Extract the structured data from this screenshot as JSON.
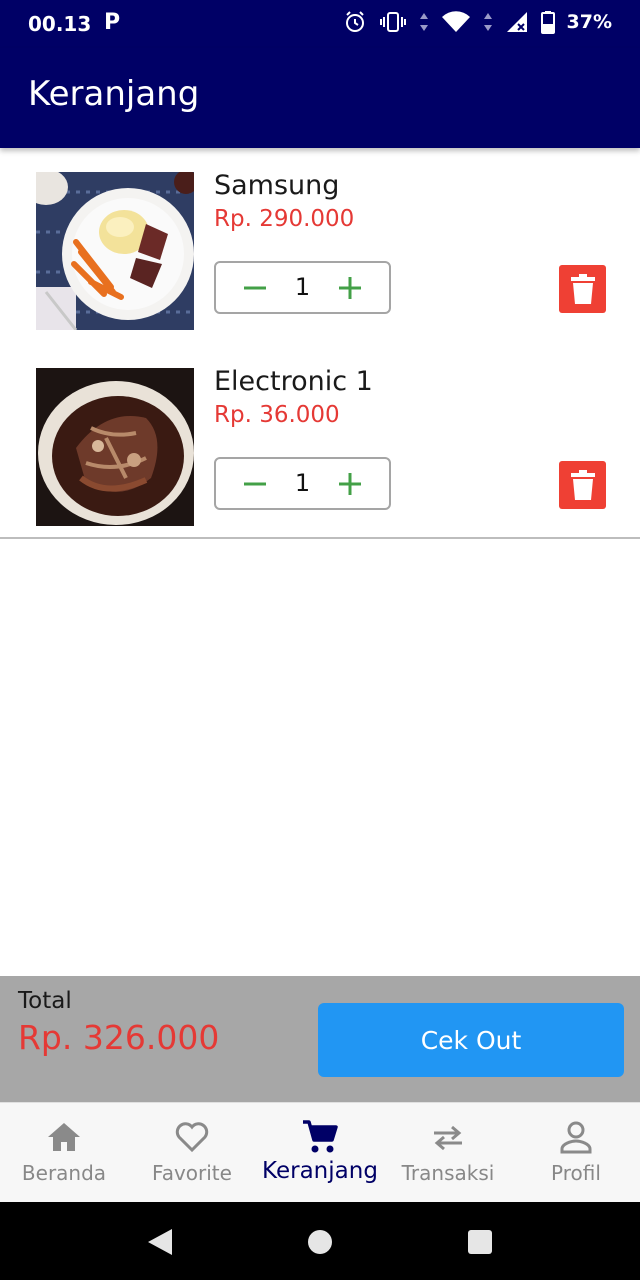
{
  "status_bar": {
    "time": "00.13",
    "app_icon_letter": "P",
    "battery": "37%"
  },
  "app_bar": {
    "title": "Keranjang"
  },
  "cart": {
    "items": [
      {
        "name": "Samsung",
        "price": "Rp. 290.000",
        "quantity": "1",
        "image": "steak-plate-photo"
      },
      {
        "name": "Electronic 1",
        "price": "Rp. 36.000",
        "quantity": "1",
        "image": "stew-bowl-photo"
      }
    ]
  },
  "summary": {
    "total_label": "Total",
    "total_value": "Rp. 326.000",
    "checkout_label": "Cek Out"
  },
  "bottom_nav": {
    "items": [
      {
        "label": "Beranda",
        "icon": "home-icon"
      },
      {
        "label": "Favorite",
        "icon": "heart-icon"
      },
      {
        "label": "Keranjang",
        "icon": "cart-icon",
        "active": true
      },
      {
        "label": "Transaksi",
        "icon": "swap-icon"
      },
      {
        "label": "Profil",
        "icon": "person-icon"
      }
    ]
  },
  "colors": {
    "primary": "#000066",
    "price": "#e53935",
    "accent_button": "#2196f3",
    "delete_button": "#ef4034",
    "quantity_control": "#43a047"
  }
}
